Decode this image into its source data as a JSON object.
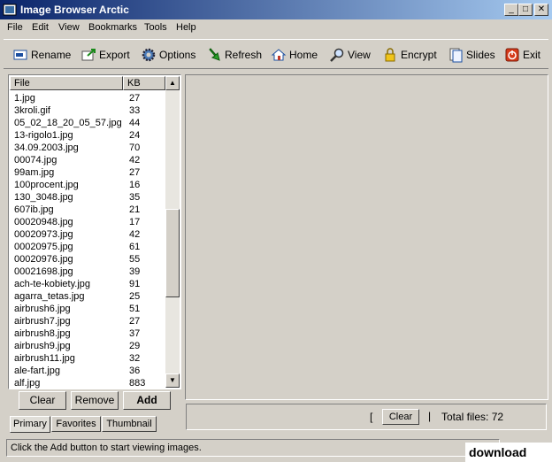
{
  "window": {
    "title": "Image Browser Arctic",
    "min_glyph": "_",
    "max_glyph": "□",
    "close_glyph": "✕"
  },
  "menu": [
    "File",
    "Edit",
    "View",
    "Bookmarks",
    "Tools",
    "Help"
  ],
  "toolbar": [
    {
      "label": "Rename",
      "icon": "rename-icon"
    },
    {
      "label": "Export",
      "icon": "export-icon"
    },
    {
      "label": "Options",
      "icon": "gear-icon"
    },
    {
      "label": "Refresh",
      "icon": "refresh-icon"
    },
    {
      "label": "Home",
      "icon": "home-icon"
    },
    {
      "label": "View",
      "icon": "magnifier-icon"
    },
    {
      "label": "Encrypt",
      "icon": "lock-icon"
    },
    {
      "label": "Slides",
      "icon": "slides-icon"
    },
    {
      "label": "Exit",
      "icon": "exit-icon"
    }
  ],
  "file_list": {
    "headers": {
      "file": "File",
      "kb": "KB"
    },
    "rows": [
      {
        "file": "1.jpg",
        "kb": "27"
      },
      {
        "file": "3kroli.gif",
        "kb": "33"
      },
      {
        "file": "05_02_18_20_05_57.jpg",
        "kb": "44"
      },
      {
        "file": "13-rigolo1.jpg",
        "kb": "24"
      },
      {
        "file": "34.09.2003.jpg",
        "kb": "70"
      },
      {
        "file": "00074.jpg",
        "kb": "42"
      },
      {
        "file": "99am.jpg",
        "kb": "27"
      },
      {
        "file": "100procent.jpg",
        "kb": "16"
      },
      {
        "file": "130_3048.jpg",
        "kb": "35"
      },
      {
        "file": "607ib.jpg",
        "kb": "21"
      },
      {
        "file": "00020948.jpg",
        "kb": "17"
      },
      {
        "file": "00020973.jpg",
        "kb": "42"
      },
      {
        "file": "00020975.jpg",
        "kb": "61"
      },
      {
        "file": "00020976.jpg",
        "kb": "55"
      },
      {
        "file": "00021698.jpg",
        "kb": "39"
      },
      {
        "file": "ach-te-kobiety.jpg",
        "kb": "91"
      },
      {
        "file": "agarra_tetas.jpg",
        "kb": "25"
      },
      {
        "file": "airbrush6.jpg",
        "kb": "51"
      },
      {
        "file": "airbrush7.jpg",
        "kb": "27"
      },
      {
        "file": "airbrush8.jpg",
        "kb": "37"
      },
      {
        "file": "airbrush9.jpg",
        "kb": "29"
      },
      {
        "file": "airbrush11.jpg",
        "kb": "32"
      },
      {
        "file": "ale-fart.jpg",
        "kb": "36"
      },
      {
        "file": "alf.jpg",
        "kb": "883"
      }
    ]
  },
  "buttons": {
    "clear": "Clear",
    "remove": "Remove",
    "add": "Add"
  },
  "tabs": [
    "Primary",
    "Favorites",
    "Thumbnail"
  ],
  "right_bar": {
    "bracket": "[",
    "clear": "Clear",
    "sep": "|",
    "total": "Total files:  72"
  },
  "status": "Click the Add button to start viewing images.",
  "watermark": "download"
}
